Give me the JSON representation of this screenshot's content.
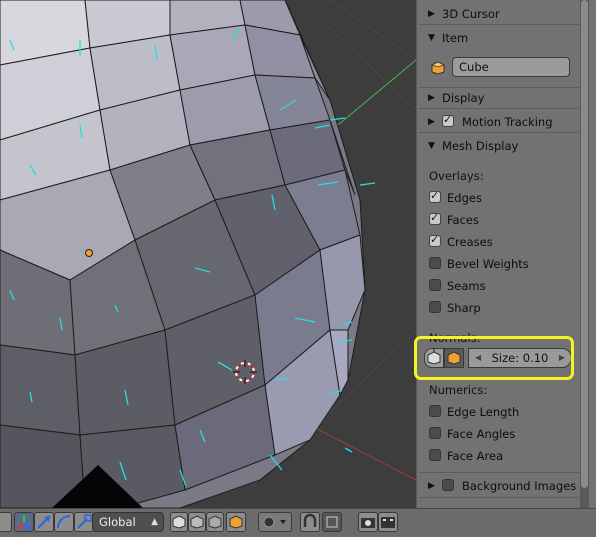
{
  "properties_panel": {
    "sections": {
      "cursor_3d": {
        "label": "3D Cursor",
        "expanded": false
      },
      "item": {
        "label": "Item",
        "expanded": true,
        "name_value": "Cube"
      },
      "display": {
        "label": "Display",
        "expanded": false
      },
      "motion_tracking": {
        "label": "Motion Tracking",
        "expanded": false,
        "checked": true
      },
      "mesh_display": {
        "label": "Mesh Display",
        "expanded": true
      },
      "background_images": {
        "label": "Background Images",
        "expanded": false,
        "checked": false
      }
    },
    "mesh_display": {
      "overlays_label": "Overlays:",
      "overlays": [
        {
          "label": "Edges",
          "checked": true
        },
        {
          "label": "Faces",
          "checked": true
        },
        {
          "label": "Creases",
          "checked": true
        },
        {
          "label": "Bevel Weights",
          "checked": false
        },
        {
          "label": "Seams",
          "checked": false
        },
        {
          "label": "Sharp",
          "checked": false
        }
      ],
      "normals_label": "Normals:",
      "normals_size": "Size: 0.10",
      "numerics_label": "Numerics:",
      "numerics": [
        {
          "label": "Edge Length",
          "checked": false
        },
        {
          "label": "Face Angles",
          "checked": false
        },
        {
          "label": "Face Area",
          "checked": false
        }
      ]
    },
    "highlight_color": "#f4f420"
  },
  "viewport": {
    "mesh_face_color": "#9c9cae",
    "normal_line_color": "#22e0e0",
    "vertex_color": "#111111"
  },
  "bottom_toolbar": {
    "orientation_value": "Global",
    "icons": [
      "transform-manipulator-icon",
      "translate-icon",
      "rotate-icon",
      "scale-icon",
      "vertex-select-icon",
      "edge-select-icon",
      "face-select-icon",
      "occlude-geometry-icon",
      "pivot-icon",
      "snap-icon",
      "render-still-icon",
      "render-animation-icon"
    ]
  }
}
